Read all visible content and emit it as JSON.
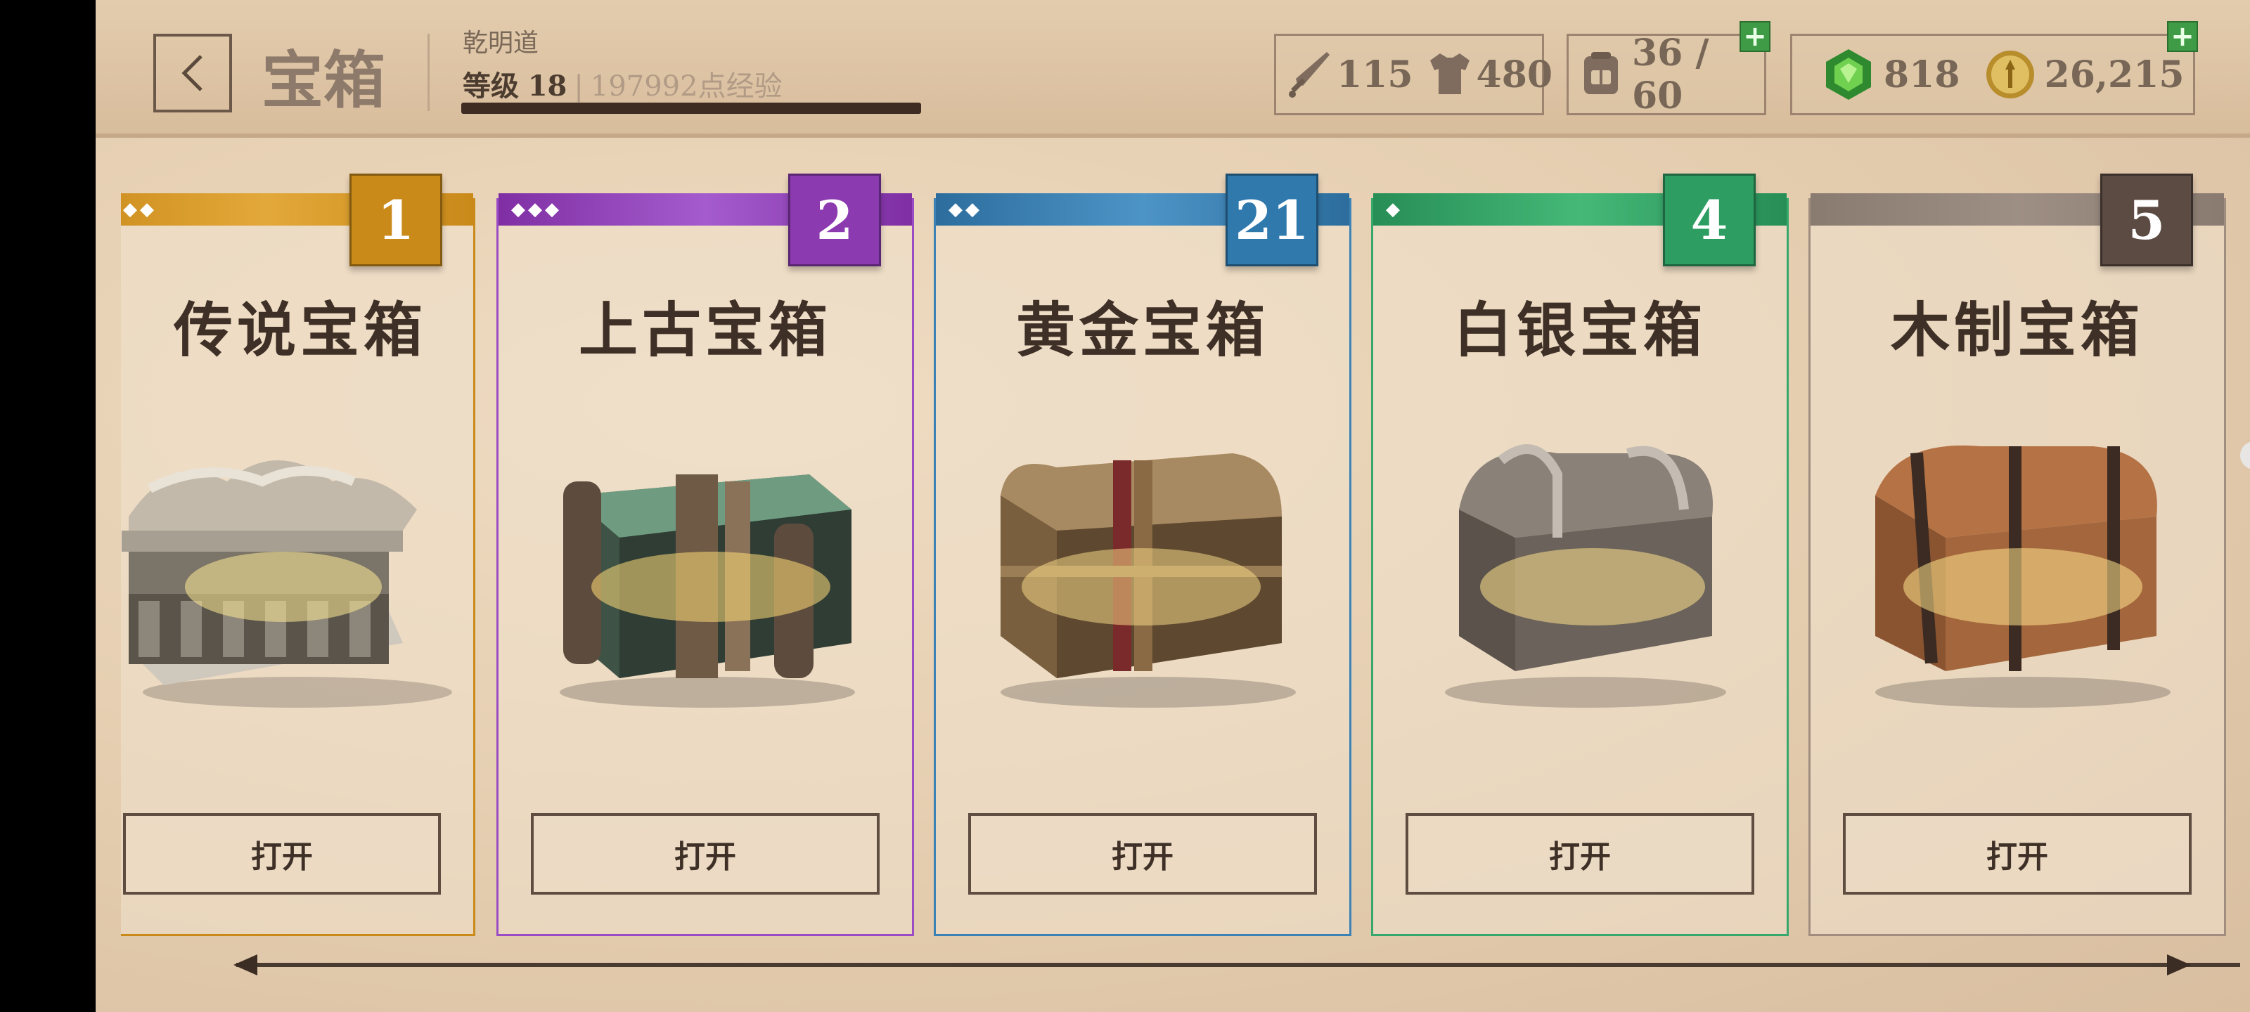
{
  "header": {
    "title": "宝箱",
    "player_name": "乾明道",
    "level_label": "等级",
    "level": "18",
    "xp_text": "197992点经验"
  },
  "stats": {
    "attack": "115",
    "armor": "480",
    "inventory": "36 / 60",
    "gems": "818",
    "gold": "26,215"
  },
  "chests": [
    {
      "name": "传说宝箱",
      "count": "1",
      "diamonds": "◆◆",
      "color": "#c98a1a",
      "open_label": "打开"
    },
    {
      "name": "上古宝箱",
      "count": "2",
      "diamonds": "◆◆◆",
      "color": "#8b3aaf",
      "open_label": "打开"
    },
    {
      "name": "黄金宝箱",
      "count": "21",
      "diamonds": "◆◆",
      "color": "#2f79ad",
      "open_label": "打开"
    },
    {
      "name": "白银宝箱",
      "count": "4",
      "diamonds": "◆",
      "color": "#2e9d61",
      "open_label": "打开"
    },
    {
      "name": "木制宝箱",
      "count": "5",
      "diamonds": "",
      "color": "#5b4b42",
      "open_label": "打开"
    }
  ]
}
